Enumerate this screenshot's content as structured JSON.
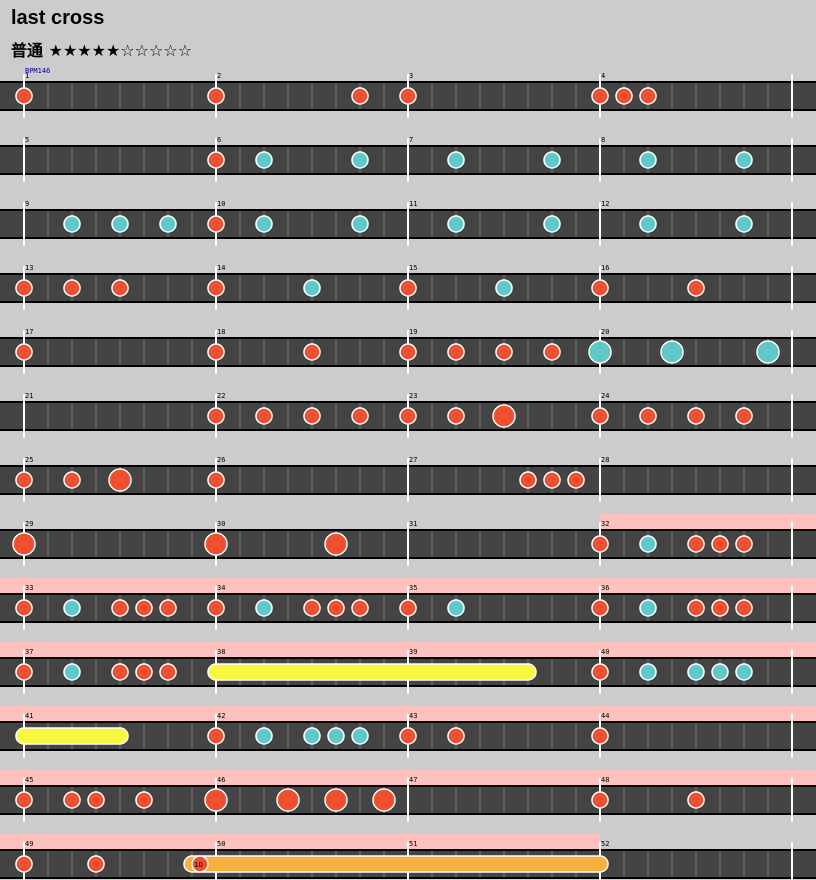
{
  "song": {
    "title": "last cross",
    "difficulty": "普通",
    "stars": "★★★★★☆☆☆☆☆"
  },
  "bpm_label": "BPM146",
  "colors": {
    "don": "#f05030",
    "ka": "#60c8c8",
    "drumroll": "#f8f840",
    "balloon": "#f8b040",
    "gogo": "#ffc0c0",
    "lane": "#444444",
    "page": "#cccccc"
  },
  "chart_data": {
    "type": "table",
    "description_units": "beat positions within measures (4 beats per measure)",
    "measures": [
      {
        "n": 1,
        "notes": [
          [
            "d",
            0
          ]
        ]
      },
      {
        "n": 2,
        "notes": [
          [
            "d",
            0
          ],
          [
            "d",
            3
          ]
        ]
      },
      {
        "n": 3,
        "notes": [
          [
            "d",
            0
          ]
        ]
      },
      {
        "n": 4,
        "notes": [
          [
            "d",
            0
          ],
          [
            "d",
            0.5
          ],
          [
            "d",
            1
          ]
        ]
      },
      {
        "n": 5,
        "notes": []
      },
      {
        "n": 6,
        "notes": [
          [
            "d",
            0
          ],
          [
            "k",
            1
          ],
          [
            "k",
            3
          ]
        ]
      },
      {
        "n": 7,
        "notes": [
          [
            "k",
            1
          ],
          [
            "k",
            3
          ]
        ]
      },
      {
        "n": 8,
        "notes": [
          [
            "k",
            1
          ],
          [
            "k",
            3
          ]
        ]
      },
      {
        "n": 9,
        "notes": [
          [
            "k",
            1
          ],
          [
            "k",
            2
          ],
          [
            "k",
            3
          ]
        ]
      },
      {
        "n": 10,
        "notes": [
          [
            "d",
            0
          ],
          [
            "k",
            1
          ],
          [
            "k",
            3
          ]
        ]
      },
      {
        "n": 11,
        "notes": [
          [
            "k",
            1
          ],
          [
            "k",
            3
          ]
        ]
      },
      {
        "n": 12,
        "notes": [
          [
            "k",
            1
          ],
          [
            "k",
            3
          ]
        ]
      },
      {
        "n": 13,
        "notes": [
          [
            "d",
            0
          ],
          [
            "d",
            1
          ],
          [
            "d",
            2
          ]
        ]
      },
      {
        "n": 14,
        "notes": [
          [
            "d",
            0
          ],
          [
            "k",
            2
          ]
        ]
      },
      {
        "n": 15,
        "notes": [
          [
            "d",
            0
          ],
          [
            "k",
            2
          ]
        ]
      },
      {
        "n": 16,
        "notes": [
          [
            "d",
            0
          ],
          [
            "d",
            2
          ]
        ]
      },
      {
        "n": 17,
        "notes": [
          [
            "d",
            0
          ]
        ]
      },
      {
        "n": 18,
        "notes": [
          [
            "d",
            0
          ],
          [
            "d",
            2
          ]
        ]
      },
      {
        "n": 19,
        "notes": [
          [
            "d",
            0
          ],
          [
            "d",
            1
          ],
          [
            "d",
            2
          ],
          [
            "d",
            3
          ]
        ]
      },
      {
        "n": 20,
        "notes": [
          [
            "K",
            0
          ],
          [
            "K",
            1.5
          ],
          [
            "K",
            3.5
          ]
        ]
      },
      {
        "n": 21,
        "notes": []
      },
      {
        "n": 22,
        "notes": [
          [
            "d",
            0
          ],
          [
            "d",
            1
          ],
          [
            "d",
            2
          ],
          [
            "d",
            3
          ]
        ]
      },
      {
        "n": 23,
        "notes": [
          [
            "d",
            0
          ],
          [
            "d",
            1
          ],
          [
            "D",
            2
          ]
        ]
      },
      {
        "n": 24,
        "notes": [
          [
            "d",
            0
          ],
          [
            "d",
            1
          ],
          [
            "d",
            2
          ],
          [
            "d",
            3
          ]
        ]
      },
      {
        "n": 25,
        "notes": [
          [
            "d",
            0
          ],
          [
            "d",
            1
          ],
          [
            "D",
            2
          ]
        ]
      },
      {
        "n": 26,
        "notes": [
          [
            "d",
            0
          ]
        ]
      },
      {
        "n": 27,
        "notes": [
          [
            "d",
            2.5
          ],
          [
            "d",
            3
          ],
          [
            "d",
            3.5
          ]
        ]
      },
      {
        "n": 28,
        "notes": []
      },
      {
        "n": 29,
        "notes": [
          [
            "D",
            0
          ]
        ]
      },
      {
        "n": 30,
        "notes": [
          [
            "D",
            0
          ],
          [
            "D",
            2.5
          ]
        ]
      },
      {
        "n": 31,
        "notes": []
      },
      {
        "n": 32,
        "notes": [
          [
            "d",
            0
          ],
          [
            "k",
            1
          ],
          [
            "d",
            2
          ],
          [
            "d",
            2.5
          ],
          [
            "d",
            3
          ]
        ]
      },
      {
        "n": 33,
        "notes": [
          [
            "d",
            0
          ],
          [
            "k",
            1
          ],
          [
            "d",
            2
          ],
          [
            "d",
            2.5
          ],
          [
            "d",
            3
          ]
        ]
      },
      {
        "n": 34,
        "notes": [
          [
            "d",
            0
          ],
          [
            "k",
            1
          ],
          [
            "d",
            2
          ],
          [
            "d",
            2.5
          ],
          [
            "d",
            3
          ]
        ]
      },
      {
        "n": 35,
        "notes": [
          [
            "d",
            0
          ],
          [
            "k",
            1
          ]
        ]
      },
      {
        "n": 36,
        "notes": [
          [
            "d",
            0
          ],
          [
            "k",
            1
          ],
          [
            "d",
            2
          ],
          [
            "d",
            2.5
          ],
          [
            "d",
            3
          ]
        ]
      },
      {
        "n": 37,
        "notes": [
          [
            "d",
            0
          ],
          [
            "k",
            1
          ],
          [
            "d",
            2
          ],
          [
            "d",
            2.5
          ],
          [
            "d",
            3
          ]
        ]
      },
      {
        "n": 38,
        "notes": []
      },
      {
        "n": 39,
        "notes": []
      },
      {
        "n": 40,
        "notes": [
          [
            "d",
            0
          ],
          [
            "k",
            1
          ],
          [
            "k",
            2
          ],
          [
            "k",
            2.5
          ],
          [
            "k",
            3
          ]
        ]
      },
      {
        "n": 41,
        "notes": []
      },
      {
        "n": 42,
        "notes": [
          [
            "d",
            0
          ],
          [
            "k",
            1
          ],
          [
            "k",
            2
          ],
          [
            "k",
            2.5
          ],
          [
            "k",
            3
          ]
        ]
      },
      {
        "n": 43,
        "notes": [
          [
            "d",
            0
          ],
          [
            "d",
            1
          ]
        ]
      },
      {
        "n": 44,
        "notes": [
          [
            "d",
            0
          ]
        ]
      },
      {
        "n": 45,
        "notes": [
          [
            "d",
            0
          ],
          [
            "d",
            1
          ],
          [
            "d",
            1.5
          ],
          [
            "d",
            2.5
          ]
        ]
      },
      {
        "n": 46,
        "notes": [
          [
            "D",
            0
          ],
          [
            "D",
            1.5
          ],
          [
            "D",
            2.5
          ],
          [
            "D",
            3.5
          ]
        ]
      },
      {
        "n": 47,
        "notes": []
      },
      {
        "n": 48,
        "notes": [
          [
            "d",
            0
          ],
          [
            "d",
            2
          ]
        ]
      },
      {
        "n": 49,
        "notes": [
          [
            "d",
            0
          ],
          [
            "d",
            1.5
          ]
        ]
      },
      {
        "n": 50,
        "notes": []
      },
      {
        "n": 51,
        "notes": []
      },
      {
        "n": 52,
        "notes": []
      }
    ],
    "drumrolls": [
      {
        "from_measure": 38,
        "from_beat": 0,
        "to_measure": 39,
        "to_beat": 2.5,
        "type": "roll"
      },
      {
        "from_measure": 41,
        "from_beat": 0,
        "to_measure": 41,
        "to_beat": 2,
        "type": "roll"
      },
      {
        "from_measure": 50,
        "from_beat": -0.5,
        "to_measure": 52,
        "to_beat": 0,
        "type": "balloon",
        "count": "10"
      }
    ],
    "gogo": [
      {
        "from_measure": 32,
        "to_measure": 44
      },
      {
        "from_measure": 45,
        "to_measure": 51
      }
    ]
  }
}
